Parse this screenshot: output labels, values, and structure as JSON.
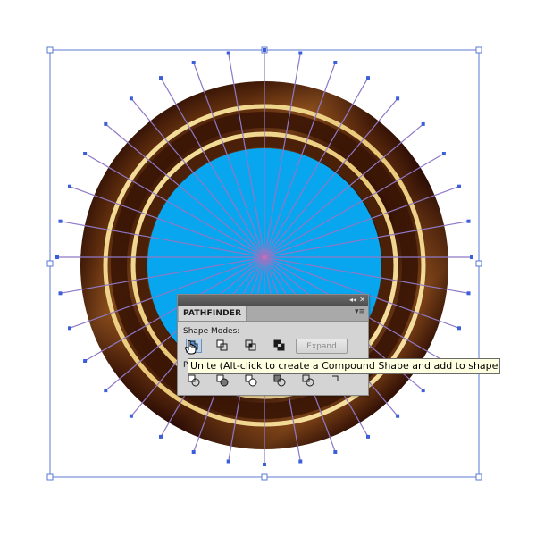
{
  "panel": {
    "tab_label": "PATHFINDER",
    "shape_modes_label": "Shape Modes:",
    "pathfinders_label": "P",
    "expand_label": "Expand",
    "collapse_glyph": "◂◂",
    "close_glyph": "✕",
    "menu_glyph": "▾≡"
  },
  "tooltip": {
    "text": "Unite (Alt-click to create a Compound Shape and add to shape"
  },
  "colors": {
    "fill_blue": "#08a6ee",
    "ring_dark": "#2a0c05",
    "ring_mid": "#7a4418",
    "gold": "#f5d98a",
    "ray_line": "#8e79c6",
    "ray_handle": "#3a5fd9",
    "selection": "#5b79d1"
  }
}
